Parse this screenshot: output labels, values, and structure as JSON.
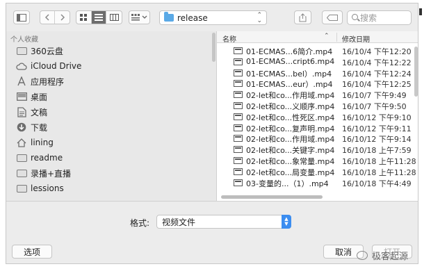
{
  "toolbar": {
    "path_label": "release",
    "search_placeholder": "搜索"
  },
  "sidebar": {
    "section_title": "个人收藏",
    "items": [
      {
        "label": "360云盘",
        "icon": "folder-icon"
      },
      {
        "label": "iCloud Drive",
        "icon": "cloud-icon"
      },
      {
        "label": "应用程序",
        "icon": "apps-icon"
      },
      {
        "label": "桌面",
        "icon": "desktop-icon"
      },
      {
        "label": "文稿",
        "icon": "document-icon"
      },
      {
        "label": "下载",
        "icon": "download-icon"
      },
      {
        "label": "lining",
        "icon": "home-icon"
      },
      {
        "label": "readme",
        "icon": "folder-icon"
      },
      {
        "label": "录播+直播",
        "icon": "folder-icon"
      },
      {
        "label": "lessions",
        "icon": "folder-icon"
      }
    ]
  },
  "file_list": {
    "col_name": "名称",
    "col_date": "修改日期",
    "rows": [
      {
        "name": "01-ECMAS...6简介.mp4",
        "date": "16/10/4 下午12:20"
      },
      {
        "name": "01-ECMAS...cript6.mp4",
        "date": "16/10/4 下午12:22"
      },
      {
        "name": "01-ECMAS...bel）.mp4",
        "date": "16/10/4 下午12:24"
      },
      {
        "name": "01-ECMAS...eur）.mp4",
        "date": "16/10/4 下午12:25"
      },
      {
        "name": "02-let和co...作用域.mp4",
        "date": "16/10/7 下午9:49"
      },
      {
        "name": "02-let和co...义顺序.mp4",
        "date": "16/10/7 下午9:50"
      },
      {
        "name": "02-let和co...性死区.mp4",
        "date": "16/10/12 下午9:10"
      },
      {
        "name": "02-let和co...复声明.mp4",
        "date": "16/10/12 下午9:11"
      },
      {
        "name": "02-let和co...作用域.mp4",
        "date": "16/10/12 下午9:14"
      },
      {
        "name": "02-let和co...关键字.mp4",
        "date": "16/10/18 上午7:59"
      },
      {
        "name": "02-let和co...象常量.mp4",
        "date": "16/10/18 上午11:28"
      },
      {
        "name": "02-let和co...局变量.mp4",
        "date": "16/10/18 上午11:28"
      },
      {
        "name": "03-变量的...（1）.mp4",
        "date": "16/10/18 下午4:49"
      }
    ]
  },
  "format": {
    "label": "格式:",
    "value": "视频文件"
  },
  "buttons": {
    "options": "选项",
    "cancel": "取消",
    "open": "打开"
  },
  "watermark": "极客起源"
}
